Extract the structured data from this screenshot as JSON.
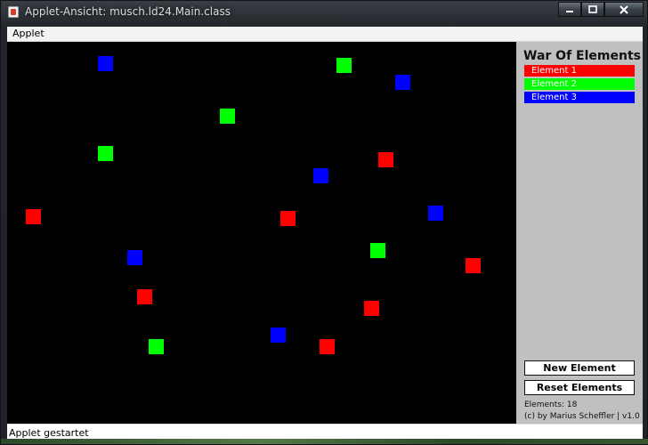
{
  "window": {
    "title": "Applet-Ansicht: musch.ld24.Main.class"
  },
  "menu": {
    "applet_label": "Applet"
  },
  "sidebar": {
    "title": "War Of Elements",
    "legend": [
      {
        "label": "Element 1",
        "color": "#ff0000"
      },
      {
        "label": "Element 2",
        "color": "#00ff00"
      },
      {
        "label": "Element 3",
        "color": "#0000ff"
      }
    ],
    "new_element_label": "New Element",
    "reset_elements_label": "Reset Elements",
    "elements_count_text": "Elements: 18",
    "credits": "(c) by Marius Scheffler | v1.0"
  },
  "status": {
    "text": "Applet gestartet"
  },
  "elements": [
    {
      "type": 3
    },
    {
      "type": 2
    },
    {
      "type": 3
    },
    {
      "type": 2
    },
    {
      "type": 2
    },
    {
      "type": 1
    },
    {
      "type": 3
    },
    {
      "type": 1
    },
    {
      "type": 1
    },
    {
      "type": 3
    },
    {
      "type": 2
    },
    {
      "type": 3
    },
    {
      "type": 1
    },
    {
      "type": 1
    },
    {
      "type": 1
    },
    {
      "type": 2
    },
    {
      "type": 3
    },
    {
      "type": 1
    }
  ]
}
